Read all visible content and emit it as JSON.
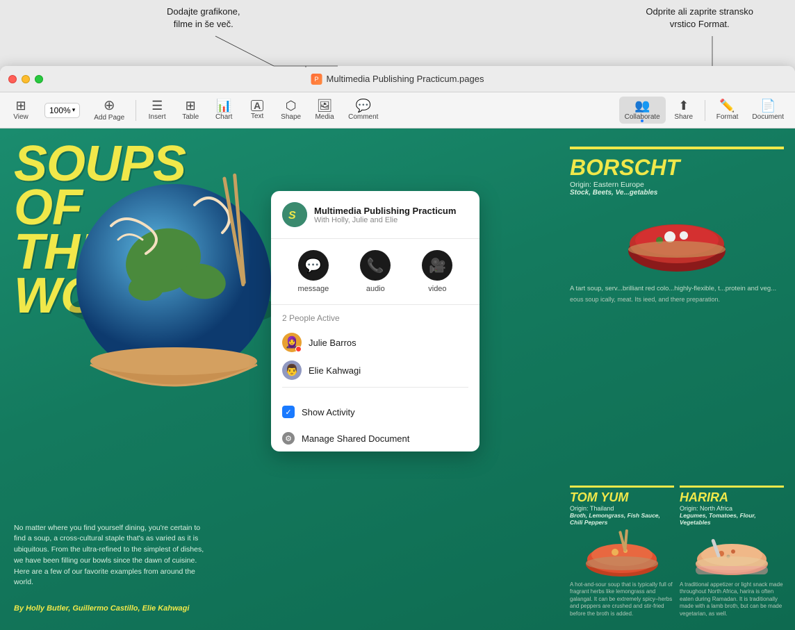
{
  "annotations": {
    "top_left": {
      "line1": "Dodajte grafikone,",
      "line2": "filme in še več."
    },
    "top_right": {
      "line1": "Odprite ali zaprite stransko",
      "line2": "vrstico Format."
    }
  },
  "window": {
    "title": "Multimedia Publishing Practicum.pages",
    "icon": "📄"
  },
  "toolbar": {
    "items": [
      {
        "id": "view",
        "icon": "⊞",
        "label": "View"
      },
      {
        "id": "zoom",
        "value": "100%",
        "label": "Zoom",
        "has_dropdown": true
      },
      {
        "id": "add-page",
        "icon": "+",
        "label": "Add Page"
      },
      {
        "id": "insert",
        "icon": "≡",
        "label": "Insert"
      },
      {
        "id": "table",
        "icon": "⊞",
        "label": "Table"
      },
      {
        "id": "chart",
        "icon": "📊",
        "label": "Chart"
      },
      {
        "id": "text",
        "icon": "A",
        "label": "Text"
      },
      {
        "id": "shape",
        "icon": "⬡",
        "label": "Shape"
      },
      {
        "id": "media",
        "icon": "🖼",
        "label": "Media"
      },
      {
        "id": "comment",
        "icon": "💬",
        "label": "Comment"
      },
      {
        "id": "collaborate",
        "icon": "👥",
        "label": "Collaborate"
      },
      {
        "id": "share",
        "icon": "⬆",
        "label": "Share"
      },
      {
        "id": "format",
        "icon": "✏️",
        "label": "Format"
      },
      {
        "id": "document",
        "icon": "📄",
        "label": "Document"
      }
    ]
  },
  "document": {
    "main_title_line1": "SOUPS",
    "main_title_line2": "OF",
    "main_title_line3": "THE",
    "main_title_line4": "WORLD",
    "body_text": "No matter where you find yourself dining, you're certain to find a soup, a cross-cultural staple that's as varied as it is ubiquitous. From the ultra-refined to the simplest of dishes, we have been filling our bowls since the dawn of cuisine. Here are a few of our favorite examples from around the world.",
    "author": "By Holly Butler, Guillermo Castillo, Elie Kahwagi",
    "borscht": {
      "title": "BORS",
      "origin_label": "Origin: Eastern",
      "ingredients": "Stock, Beets, Ve...",
      "description": "A tart soup, serv... brilliant red colo... highly-flexible, t... protein and veg..."
    },
    "tom_yum": {
      "title": "TOM YUM",
      "origin": "Origin: Thailand",
      "ingredients": "Broth, Lemongrass, Fish Sauce, Chili Peppers",
      "description": "A hot-and-sour soup that is typically full of fragrant herbs like lemongrass and galangal. It can be extremely spicy–herbs and peppers are crushed and stir-fried before the broth is added."
    },
    "harira": {
      "title": "HARIRA",
      "origin": "Origin: North Africa",
      "ingredients": "Legumes, Tomatoes, Flour, Vegetables",
      "description": "A traditional appetizer or light snack made throughout North Africa, harira is often eaten during Ramadan. It is traditionally made with a lamb broth, but can be made vegetarian, as well."
    },
    "right_description": "eous soup ically, meat. Its ieed, and there preparation."
  },
  "collaboration_popup": {
    "document_title": "Multimedia Publishing Practicum",
    "collaborators_subtitle": "With Holly, Julie and Elie",
    "actions": [
      {
        "id": "message",
        "icon": "💬",
        "label": "message"
      },
      {
        "id": "audio",
        "icon": "📞",
        "label": "audio"
      },
      {
        "id": "video",
        "icon": "🎥",
        "label": "video"
      }
    ],
    "people_count": "2 People Active",
    "people": [
      {
        "id": "julie",
        "name": "Julie Barros",
        "emoji": "👩",
        "color": "#e8a030",
        "status": "active"
      },
      {
        "id": "elie",
        "name": "Elie Kahwagi",
        "emoji": "👦",
        "color": "#a0a8d0",
        "status": "active"
      }
    ],
    "show_activity_label": "Show Activity",
    "manage_label": "Manage Shared Document"
  }
}
